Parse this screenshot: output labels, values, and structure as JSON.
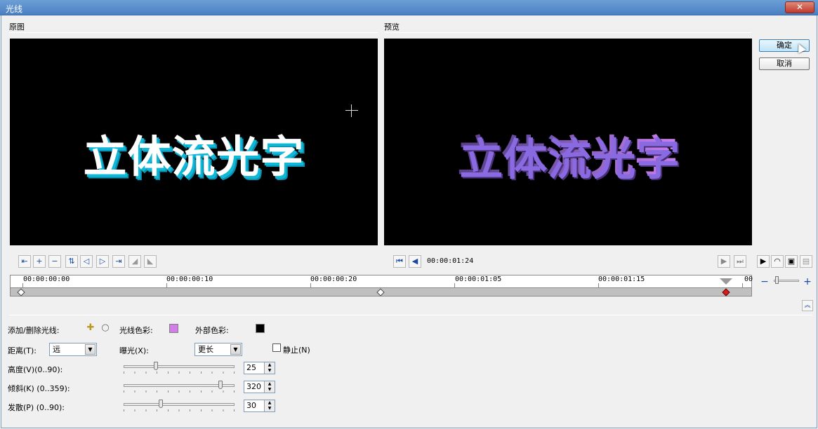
{
  "window": {
    "title": "光线",
    "close_label": "✕"
  },
  "panels": {
    "original_label": "原图",
    "preview_label": "预览",
    "overlay_text": "立体流光字"
  },
  "buttons": {
    "ok": "确定",
    "cancel": "取消"
  },
  "playback": {
    "timecode": "00:00:01:24"
  },
  "timeline": {
    "ruler": [
      "00:00:00:00",
      "00:00:00:10",
      "00:00:00:20",
      "00:00:01:05",
      "00:00:01:15",
      "00"
    ]
  },
  "controls": {
    "add_remove_label": "添加/删除光线:",
    "light_color_label": "光线色彩:",
    "light_color": "#d17ee8",
    "outer_color_label": "外部色彩:",
    "outer_color": "#000000",
    "distance_label": "距离(T):",
    "distance_value": "远",
    "exposure_label": "曝光(X):",
    "exposure_value": "更长",
    "static_label": "静止(N)",
    "height_label": "高度(V)(0..90):",
    "height_value": "25",
    "tilt_label": "倾斜(K) (0..359):",
    "tilt_value": "320",
    "spread_label": "发散(P) (0..90):",
    "spread_value": "30"
  },
  "slider_levels": {
    "height": 0.28,
    "tilt": 0.89,
    "spread": 0.33
  }
}
